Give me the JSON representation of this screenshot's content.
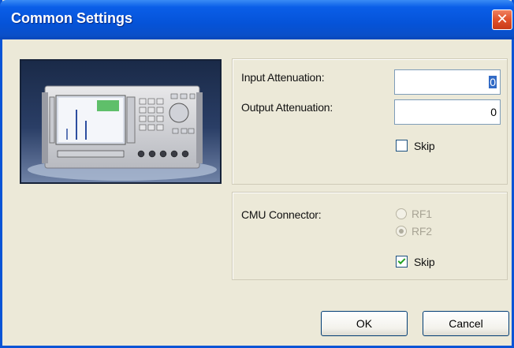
{
  "window": {
    "title": "Common Settings"
  },
  "icons": {
    "close": "close-icon",
    "photo": "cmu-device-photo"
  },
  "attenuation": {
    "input_label": "Input Attenuation:",
    "input_value": "0",
    "output_label": "Output Attenuation:",
    "output_value": "0",
    "skip_label": "Skip",
    "skip_checked": false
  },
  "connector": {
    "label": "CMU Connector:",
    "options": [
      {
        "label": "RF1",
        "selected": false,
        "disabled": true
      },
      {
        "label": "RF2",
        "selected": true,
        "disabled": true
      }
    ],
    "skip_label": "Skip",
    "skip_checked": true
  },
  "buttons": {
    "ok": "OK",
    "cancel": "Cancel"
  },
  "colors": {
    "title_bar": "#0553d8",
    "close_button": "#e0502a",
    "dialog_bg": "#ece9d8"
  }
}
